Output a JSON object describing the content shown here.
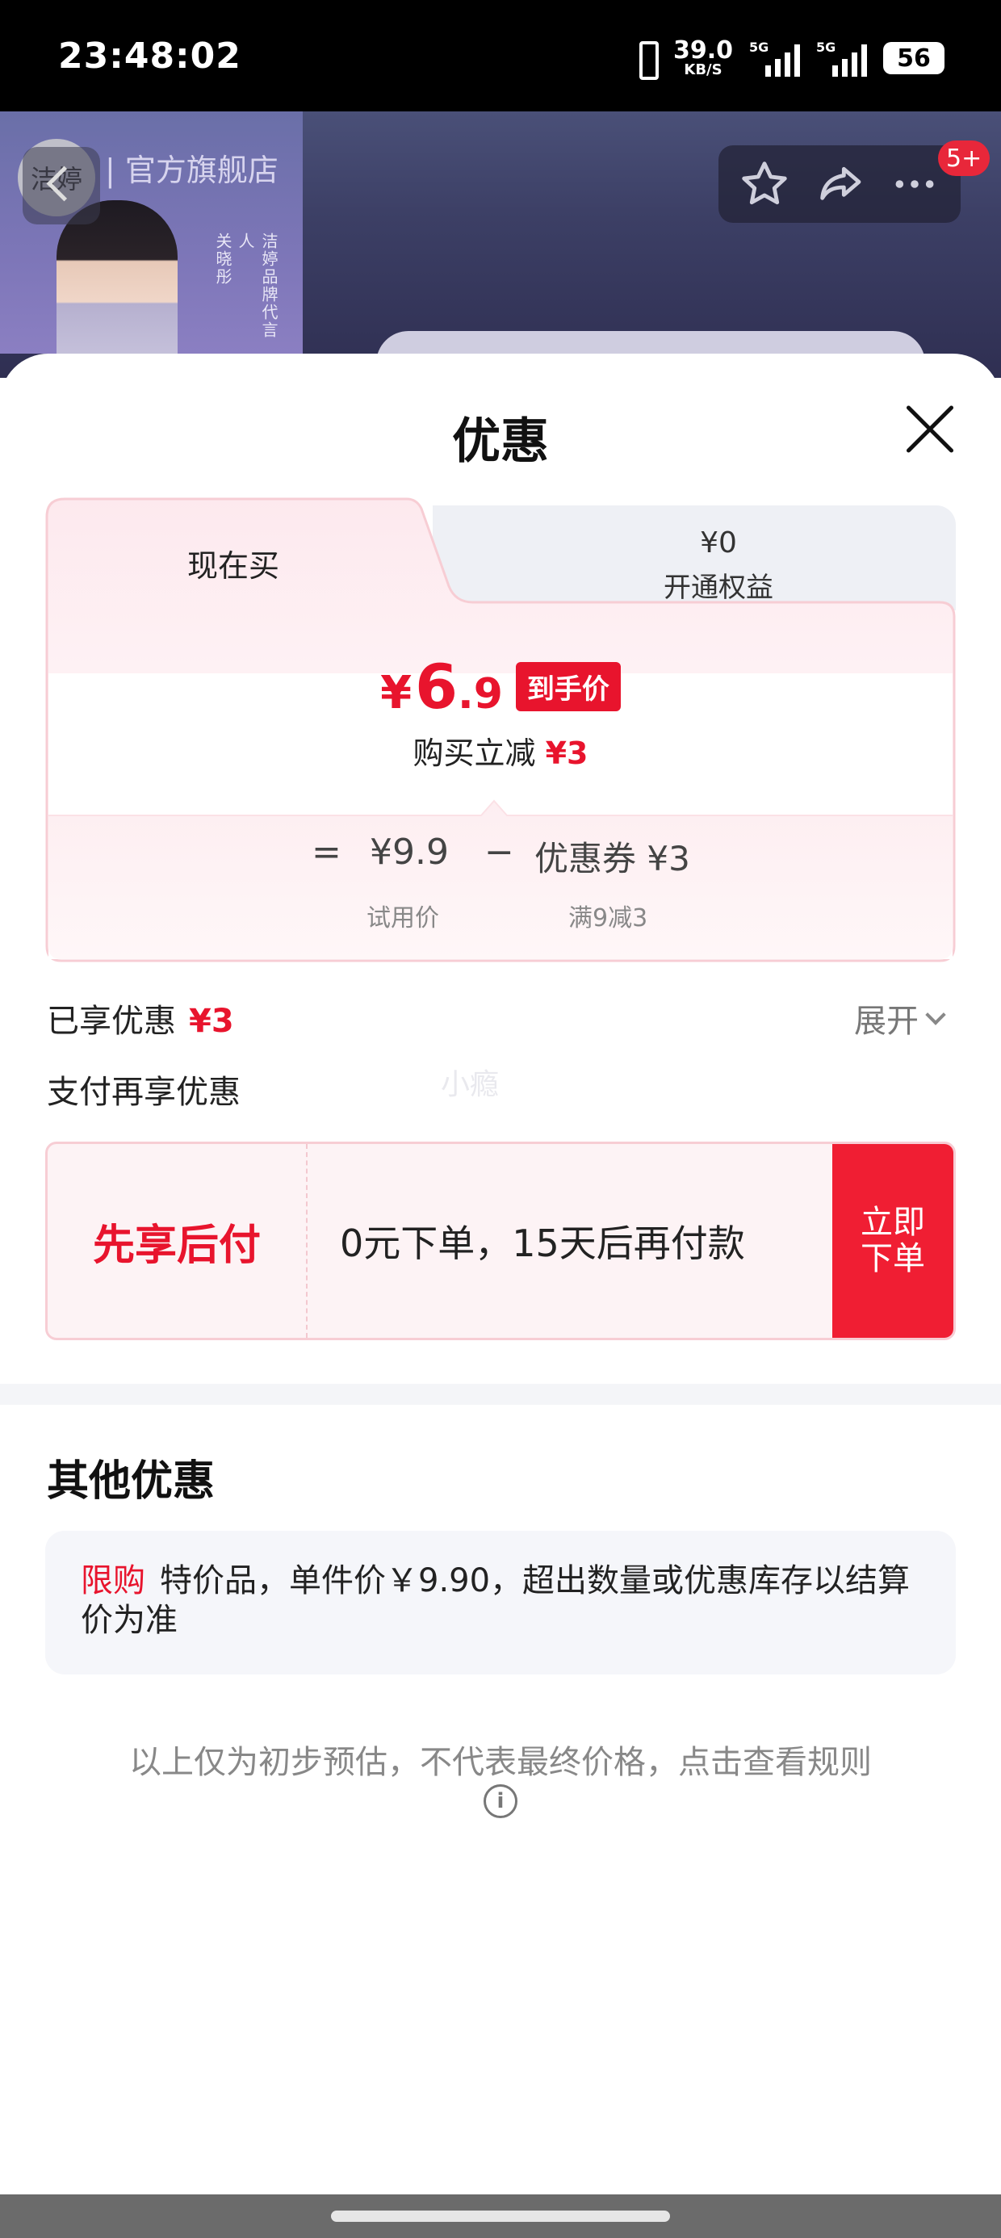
{
  "status_bar": {
    "time": "23:48:02",
    "net_speed": "39.0",
    "net_unit": "KB/S",
    "sim1_label": "5G",
    "sim2_label": "5G",
    "battery": "56"
  },
  "store": {
    "logo_text": "洁婷",
    "name": "| 官方旗舰店",
    "spokesperson_role": "洁婷品牌代言人",
    "spokesperson_name": "关晓彤",
    "notification_count": "5+"
  },
  "sheet": {
    "title": "优惠",
    "tabs": {
      "active_label": "现在买",
      "inactive_amount": "¥0",
      "inactive_label": "开通权益"
    },
    "final_price": {
      "yen": "¥",
      "integer": "6",
      "decimal": ".9",
      "tag": "到手价"
    },
    "reduce": {
      "label": "购买立减",
      "amount": "¥3"
    },
    "formula": {
      "eq": "=",
      "trial_price": "¥9.9",
      "minus": "−",
      "coupon": "优惠券 ¥3",
      "trial_label": "试用价",
      "coupon_rule": "满9减3"
    },
    "enjoyed": {
      "label": "已享优惠",
      "amount": "¥3",
      "expand_label": "展开"
    },
    "pay_more_label": "支付再享优惠",
    "watermark": "小瘾",
    "bnpl": {
      "title": "先享后付",
      "desc": "0元下单，15天后再付款",
      "button": "立即下单"
    },
    "other": {
      "title": "其他优惠",
      "limit_tag": "限购",
      "limit_text": "特价品，单件价￥9.90，超出数量或优惠库存以结算价为准"
    },
    "disclaimer": "以上仅为初步预估，不代表最终价格，点击查看规则"
  },
  "colors": {
    "accent_red": "#e8142d",
    "card_border": "#f7cdd4",
    "status_bar_bg": "#000000"
  },
  "icons": [
    "back-icon",
    "star-icon",
    "share-icon",
    "more-icon",
    "close-icon",
    "chevron-down-icon",
    "info-icon"
  ]
}
